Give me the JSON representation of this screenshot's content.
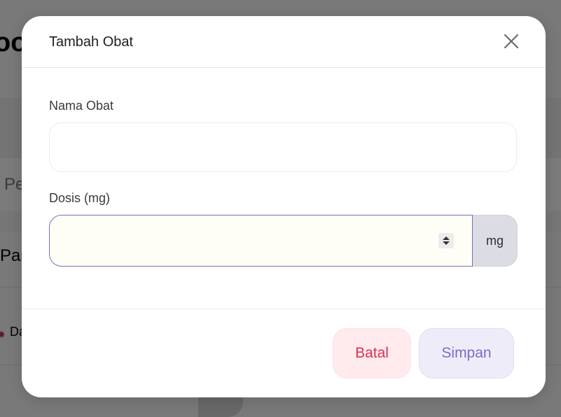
{
  "background": {
    "title_fragment": "oo",
    "search_fragment": "Pe",
    "section_fragment": "Pas",
    "row_fragment": "Da"
  },
  "modal": {
    "title": "Tambah Obat",
    "close_icon": "close-icon",
    "fields": {
      "name": {
        "label": "Nama Obat",
        "value": "",
        "placeholder": ""
      },
      "dose": {
        "label": "Dosis (mg)",
        "value": "",
        "placeholder": "",
        "unit": "mg"
      }
    },
    "footer": {
      "cancel_label": "Batal",
      "save_label": "Simpan"
    }
  },
  "colors": {
    "cancel_text": "#d8334f",
    "cancel_bg": "#ffeaee",
    "save_text": "#7e6bc6",
    "save_bg": "#efecfa",
    "focus_border": "#7a6fb8",
    "unit_bg": "#dcdde4"
  }
}
